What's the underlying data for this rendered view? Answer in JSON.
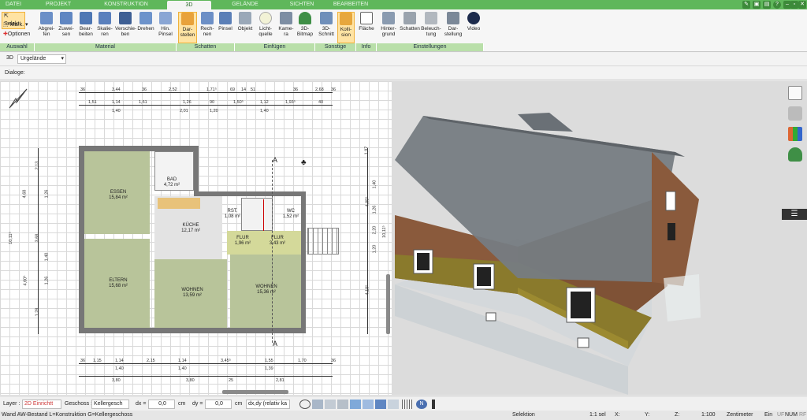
{
  "tabs": [
    "DATEI",
    "PROJEKT",
    "KONSTRUKTION",
    "3D",
    "GELÄNDE",
    "SICHTEN",
    "BEARBEITEN"
  ],
  "active_tab": "3D",
  "window_controls": [
    "pen-icon",
    "save-icon",
    "floppy-icon",
    "help-icon",
    "minimize-icon",
    "restore-icon",
    "close-icon"
  ],
  "auswahl": {
    "select_label": "Selekt",
    "mark_label": "Mark.",
    "options_label": "Optionen",
    "group_label": "Auswahl"
  },
  "ribbon_groups": {
    "material": {
      "label": "Material",
      "buttons": [
        "Abgrei-\nfen",
        "Zuwei-\nsen",
        "Bear-\nbeiten",
        "Skalie-\nren",
        "Verschie-\nben",
        "Drehen",
        "Hin.\nPinsel"
      ]
    },
    "schatten": {
      "label": "Schatten",
      "buttons": [
        "Dar-\nstellen",
        "Rech-\nnen",
        "Pinsel"
      ]
    },
    "einfuegen": {
      "label": "Einfügen",
      "buttons": [
        "Objekt",
        "Licht-\nquelle",
        "Kame-\nra",
        "3D-\nBitmap"
      ]
    },
    "sonstige": {
      "label": "Sonstige",
      "buttons": [
        "3D-\nSchnitt",
        "Kolli-\nsion"
      ]
    },
    "info": {
      "label": "Info",
      "buttons": [
        "Fläche"
      ]
    },
    "einstellungen": {
      "label": "Einstellungen",
      "buttons": [
        "Hinter-\ngrund",
        "Schatten",
        "Beleuch-\ntung",
        "Dar-\nstellung",
        "Video"
      ]
    }
  },
  "view_selector": {
    "mode": "3D",
    "value": "Urgelände"
  },
  "dialog_label": "Dialoge:",
  "plan": {
    "rooms": [
      {
        "name": "ESSEN",
        "area": "15,84 m²"
      },
      {
        "name": "BAD",
        "area": "4,72 m²"
      },
      {
        "name": "KÜCHE",
        "area": "12,17 m²"
      },
      {
        "name": "RST.",
        "area": "1,08 m²"
      },
      {
        "name": "WC",
        "area": "1,52 m²"
      },
      {
        "name": "FLUR",
        "area": "1,96 m²"
      },
      {
        "name": "FLUR",
        "area": "3,43 m²"
      },
      {
        "name": "ELTERN",
        "area": "15,68 m²"
      },
      {
        "name": "WOHNEN",
        "area": "13,59 m²"
      },
      {
        "name": "WOHNEN",
        "area": "15,36 m²"
      }
    ],
    "section_markers": [
      "A",
      "A"
    ],
    "top_dims_row1": [
      "36",
      "3,44",
      "36",
      "2,52",
      "1,71⁵",
      "69",
      "14",
      "51",
      "36",
      "2,68",
      "36"
    ],
    "top_dims_row2": [
      "1,51",
      "1,14",
      "1,51",
      "1,26",
      "90",
      "1,50⁵",
      "1,12",
      "1,93⁵",
      "40"
    ],
    "top_dims_row3": [
      "1,40",
      "2,01",
      "1,20",
      "1,40"
    ],
    "bottom_dims_row1": [
      "36",
      "1,15",
      "1,14",
      "2,15",
      "1,14",
      "3,45⁵",
      "1,55",
      "1,70",
      "36"
    ],
    "bottom_dims_row2": [
      "1,40",
      "1,40",
      "1,39"
    ],
    "bottom_dims_row3": [
      "3,80",
      "3,80",
      "25",
      "2,81"
    ],
    "left_dims": [
      "2,13",
      "1,26",
      "4,68",
      "3,68",
      "1,26",
      "4,60⁵",
      "1,40",
      "1,28",
      "10,11⁵"
    ],
    "right_dims": [
      "1,97",
      "1,40",
      "1,26",
      "2,20",
      "1,20",
      "4,85⁵",
      "4,18⁵",
      "10,11⁵"
    ]
  },
  "statusbar": {
    "layer_label": "Layer :",
    "layer_value": "2D Einrichtt",
    "geschoss_label": "Geschoss :",
    "geschoss_value": "Kellergesch",
    "dx_label": "dx =",
    "dx_value": "0,0",
    "dx_unit": "cm",
    "dy_label": "dy =",
    "dy_value": "0,0",
    "dy_unit": "cm",
    "mode_value": "dx,dy (relativ ka"
  },
  "infobar": {
    "wall_info": "Wand AW-Bestand L=Konstruktion G=Kellergeschoss",
    "mode": "Selektion",
    "sel": "1:1 sel",
    "x_label": "X:",
    "y_label": "Y:",
    "z_label": "Z:",
    "scale": "1:100",
    "unit": "Zentimeter",
    "ein": "Ein",
    "uf": "UF",
    "num": "NUM",
    "rf": "RF"
  },
  "colors": {
    "tab_green": "#5fb75b",
    "group_label_green": "#b9dfa9",
    "active_orange": "#ffe3a3",
    "room_fill": "#b8c49a",
    "kitchen_strip": "#e8c27a",
    "roof_gray": "#7c8288",
    "brick_brown": "#8a5a3c",
    "floor_olive": "#8a7a2c"
  }
}
